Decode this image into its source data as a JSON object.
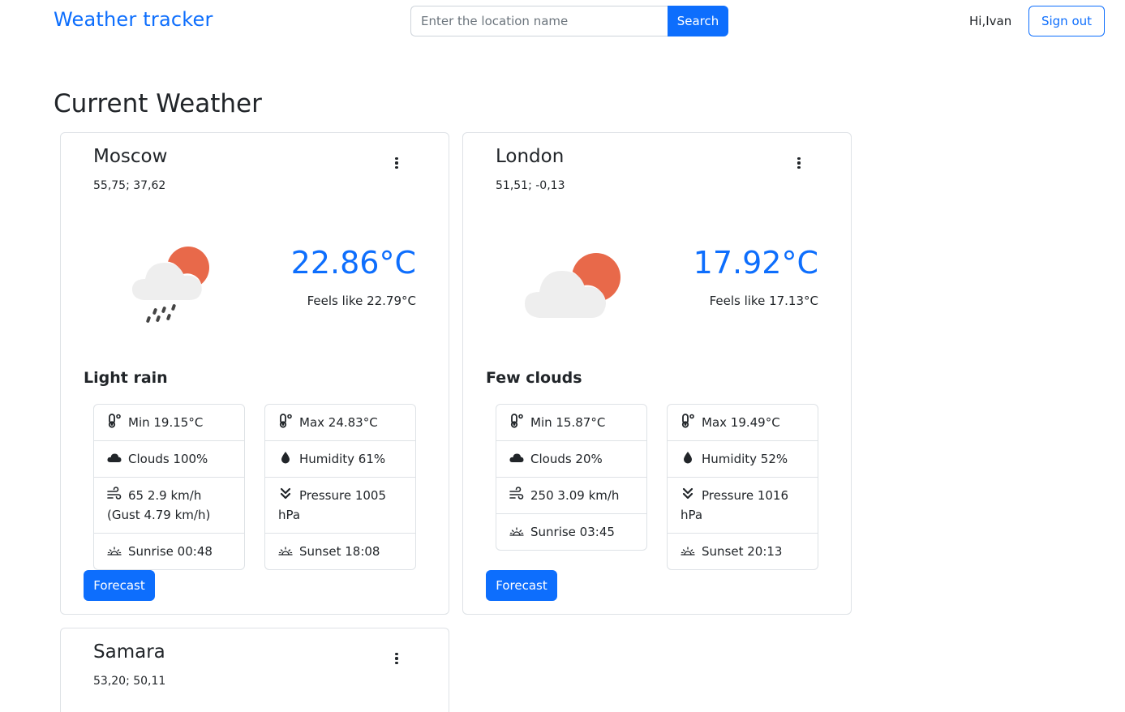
{
  "header": {
    "brand": "Weather tracker",
    "search_placeholder": "Enter the location name",
    "search_value": "",
    "search_button": "Search",
    "greeting": "Hi,Ivan",
    "signout_button": "Sign out"
  },
  "main": {
    "title": "Current Weather"
  },
  "colors": {
    "accent": "#0d6efd",
    "sun": "#e8694a",
    "cloud": "#eeeeee",
    "rain": "#444444"
  },
  "cards": [
    {
      "city": "Moscow",
      "coords": "55,75; 37,62",
      "icon": "sun-cloud-rain-icon",
      "temp": "22.86°C",
      "feels": "Feels like 22.79°C",
      "description": "Light rain",
      "min": "Min 19.15°C",
      "max": "Max 24.83°C",
      "clouds": "Clouds 100%",
      "humidity": "Humidity 61%",
      "wind": "65 2.9 km/h (Gust 4.79 km/h)",
      "pressure": "Pressure 1005 hPa",
      "sunrise": "Sunrise 00:48",
      "sunset": "Sunset 18:08",
      "forecast_button": "Forecast"
    },
    {
      "city": "London",
      "coords": "51,51; -0,13",
      "icon": "sun-cloud-icon",
      "temp": "17.92°C",
      "feels": "Feels like 17.13°C",
      "description": "Few clouds",
      "min": "Min 15.87°C",
      "max": "Max 19.49°C",
      "clouds": "Clouds 20%",
      "humidity": "Humidity 52%",
      "wind": "250 3.09 km/h",
      "pressure": "Pressure 1016 hPa",
      "sunrise": "Sunrise 03:45",
      "sunset": "Sunset 20:13",
      "forecast_button": "Forecast"
    },
    {
      "city": "Samara",
      "coords": "53,20; 50,11"
    }
  ]
}
